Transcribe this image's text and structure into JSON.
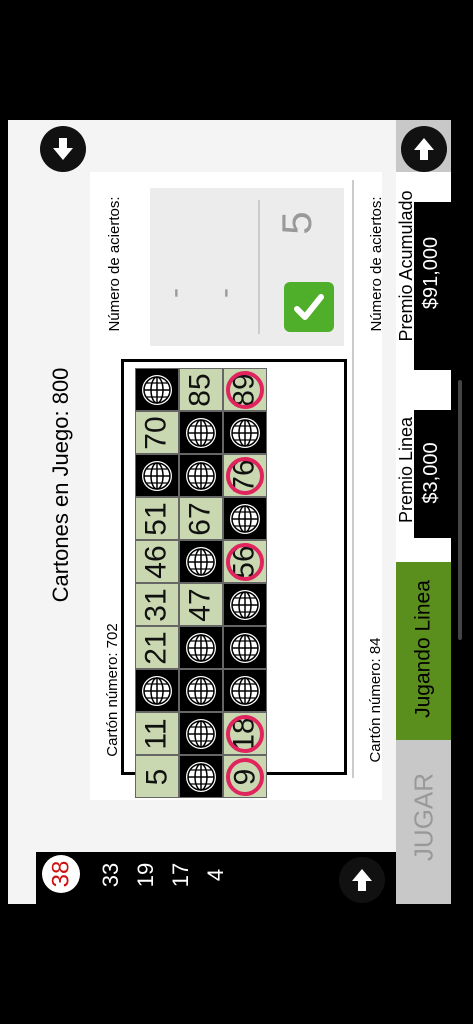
{
  "header": {
    "cartones_en_juego": "Cartones en Juego: 800"
  },
  "called_numbers": {
    "current": "38",
    "previous": [
      "33",
      "19",
      "17",
      "4"
    ]
  },
  "cards": [
    {
      "label": "Cartón número: 702",
      "aciertos_label": "Número de aciertos:",
      "aciertos_value": "5",
      "dashes": [
        "-",
        "-"
      ],
      "grid": [
        [
          "5",
          "11",
          "",
          "21",
          "31",
          "46",
          "51",
          "",
          "70",
          ""
        ],
        [
          "",
          "",
          "",
          "",
          "47",
          "",
          "67",
          "",
          "",
          "85"
        ],
        [
          "9",
          "18",
          "",
          "",
          "",
          "56",
          "",
          "76",
          "",
          "89"
        ]
      ],
      "marked": [
        "9",
        "18",
        "56",
        "76",
        "89"
      ]
    },
    {
      "label": "Cartón número: 84",
      "aciertos_label": "Número de aciertos:"
    }
  ],
  "status": {
    "jugar_label": "JUGAR",
    "jugando_label": "Jugando Linea",
    "premio_linea_label": "Premio Linea",
    "premio_linea_value": "$3,000",
    "premio_acumulado_label": "Premio Acumulado",
    "premio_acumulado_value": "$91,000"
  },
  "colors": {
    "mark": "#e0245e",
    "cell_green": "#c9d8b1",
    "jugando_green": "#5a8f1e",
    "check_green": "#4fae2a"
  }
}
